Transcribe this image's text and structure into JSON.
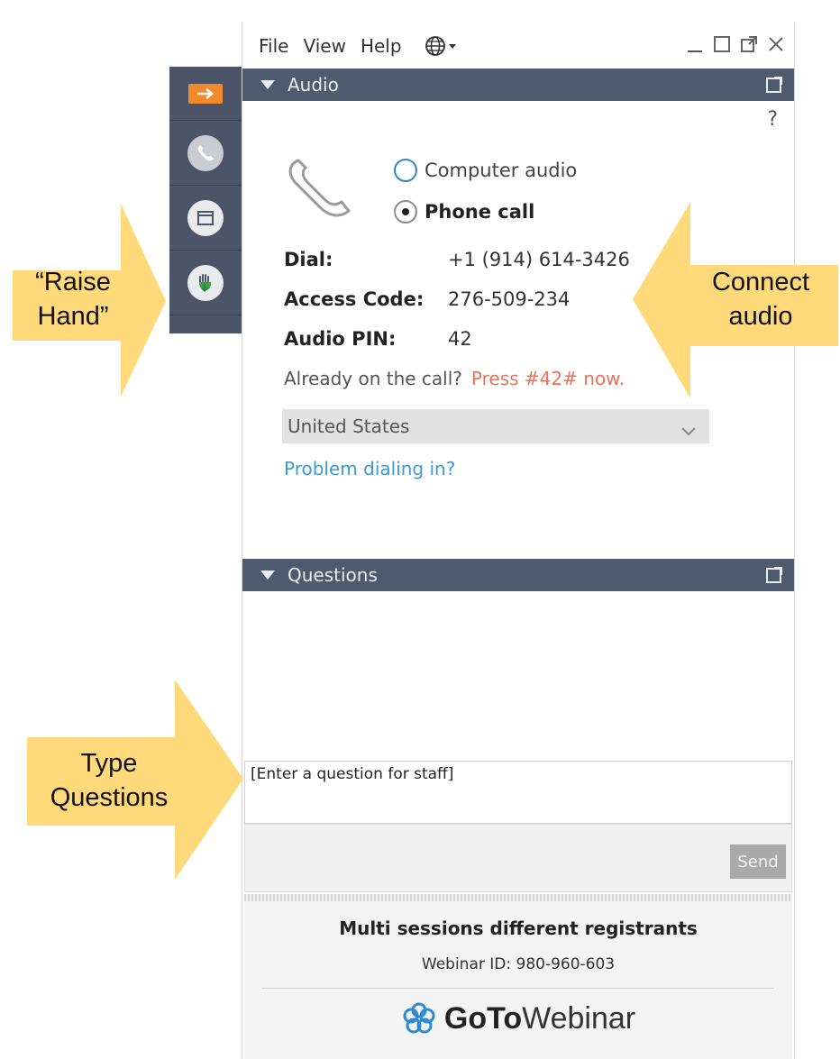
{
  "menubar": {
    "items": [
      "File",
      "View",
      "Help"
    ],
    "language_icon": "globe-icon"
  },
  "window_controls": [
    "minimize-icon",
    "maximize-icon",
    "popout-icon",
    "close-icon"
  ],
  "audio_panel": {
    "title": "Audio",
    "help": "?",
    "options": {
      "computer": "Computer audio",
      "phone": "Phone call",
      "selected": "phone"
    },
    "dial_label": "Dial:",
    "dial_value": "+1 (914) 614-3426",
    "access_label": "Access Code:",
    "access_value": "276-509-234",
    "pin_label": "Audio PIN:",
    "pin_value": "42",
    "already_text": "Already on the call?",
    "press_text": "Press #42# now.",
    "country": "United States",
    "problem_link": "Problem dialing in?"
  },
  "questions_panel": {
    "title": "Questions",
    "input_placeholder": "[Enter a question for staff]",
    "send_label": "Send"
  },
  "footer": {
    "session_name": "Multi sessions different registrants",
    "webinar_id": "Webinar ID: 980-960-603",
    "brand_bold": "GoTo",
    "brand_rest": "Webinar"
  },
  "side_toolbar": [
    "arrow-right-icon",
    "phone-icon",
    "window-icon",
    "raise-hand-icon"
  ],
  "callouts": {
    "raise_hand": [
      "“Raise",
      "Hand”"
    ],
    "connect_audio": [
      "Connect",
      "audio"
    ],
    "type_questions": [
      "Type",
      "Questions"
    ]
  },
  "colors": {
    "header": "#4e5a6d",
    "toolbar": "#4b5567",
    "accent_orange": "#f08a2a",
    "radio_blue": "#2f87c6",
    "link_blue": "#3e9ad2",
    "press_red": "#e8735c",
    "callout_yellow": "#ffd97a"
  }
}
